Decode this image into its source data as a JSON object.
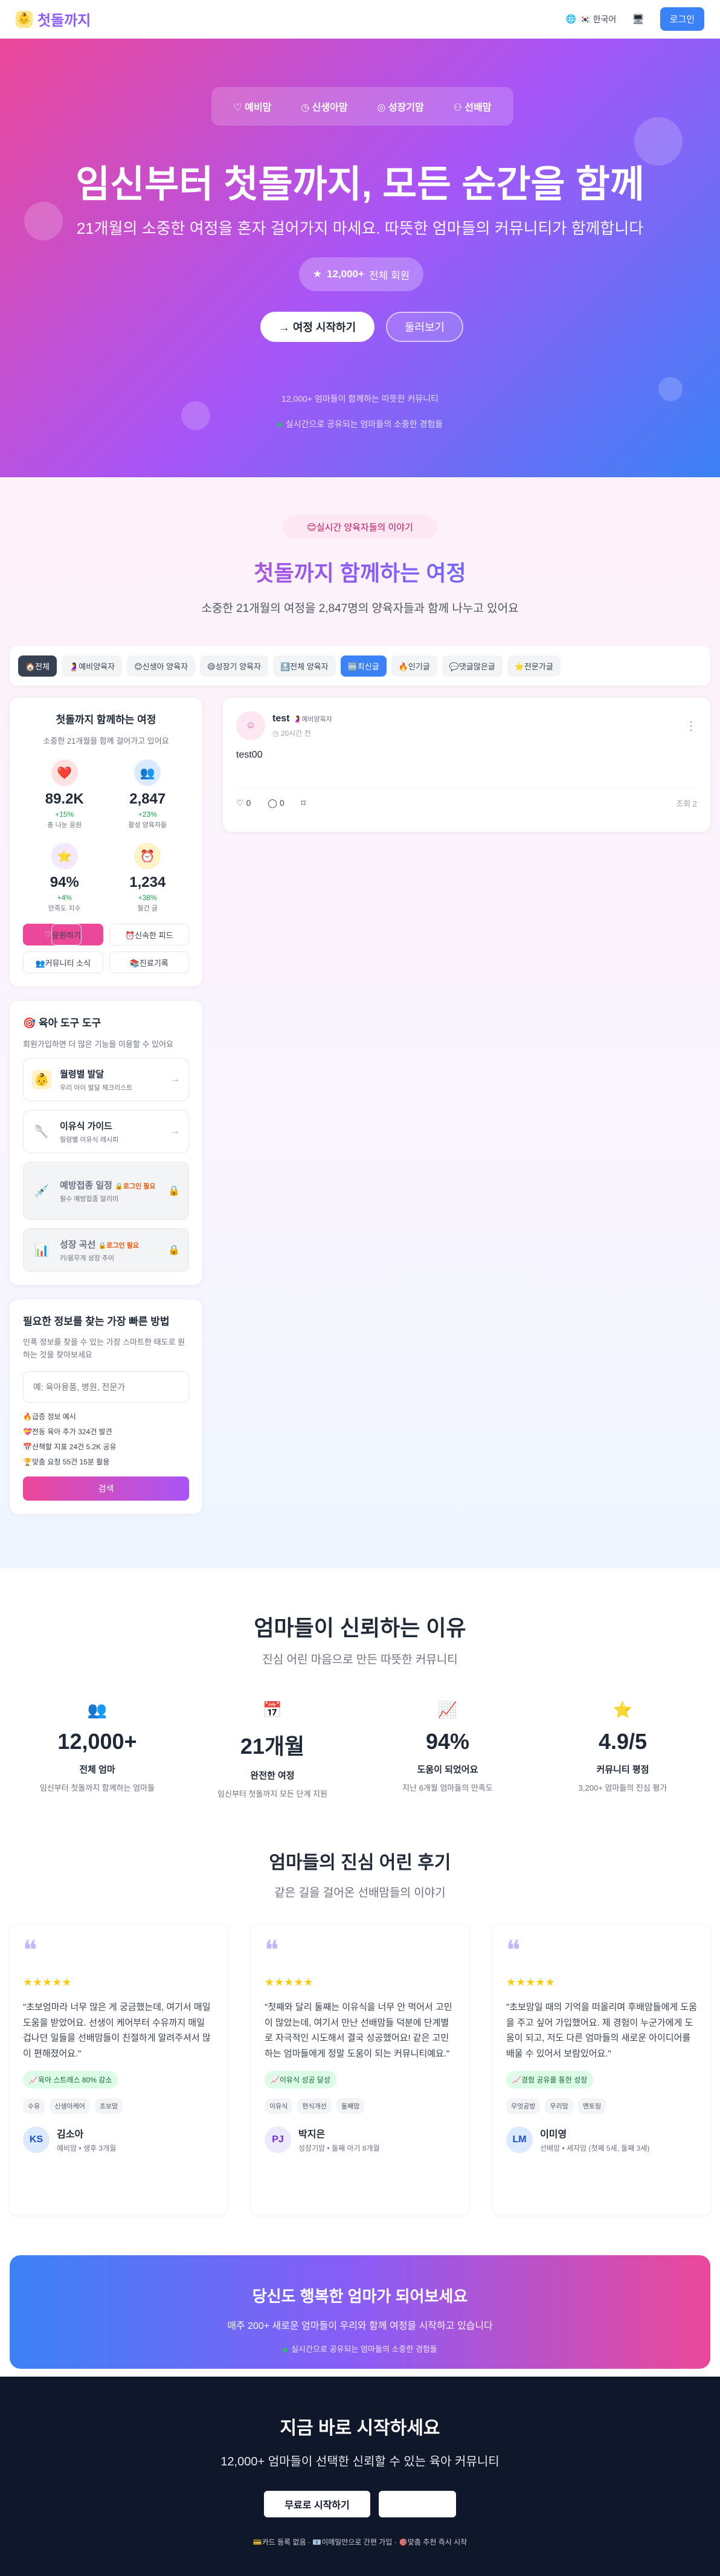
{
  "nav": {
    "logo": "첫돌까지",
    "lang": "🇰🇷 한국어",
    "login": "로그인"
  },
  "hero": {
    "tabs": [
      "예비맘",
      "신생아맘",
      "성장기맘",
      "선배맘"
    ],
    "title": "임신부터 첫돌까지, 모든 순간을 함께",
    "subtitle": "21개월의 소중한 여정을 혼자 걸어가지 마세요. 따뜻한 엄마들의 커뮤니티가 함께합니다",
    "members_count": "12,000+",
    "members_label": "전체 회원",
    "cta_primary": "여정 시작하기",
    "cta_secondary": "둘러보기",
    "note1": "12,000+ 엄마들이 함께하는 따뜻한 커뮤니티",
    "note2": "실시간으로 공유되는 엄마들의 소중한 경험들"
  },
  "journey": {
    "tag": "😊실시간 양육자들의 이야기",
    "title": "첫돌까지 함께하는 여정",
    "subtitle": "소중한 21개월의 여정을 2,847명의 양육자들과 함께 나누고 있어요",
    "filters": [
      "🏠전체",
      "🤰예비양육자",
      "😊신생아 양육자",
      "😄성장기 양육자",
      "🔝전체 양육자",
      "🆕최신글",
      "🔥인기글",
      "💬댓글많은글",
      "⭐전문가글"
    ]
  },
  "stats_card": {
    "title": "첫돌까지 함께하는 여정",
    "subtitle": "소중한 21개월을 함께 걸어가고 있어요",
    "items": [
      {
        "icon": "❤️",
        "value": "89.2K",
        "delta": "+15%",
        "label": "총 나눈 응원"
      },
      {
        "icon": "👥",
        "value": "2,847",
        "delta": "+23%",
        "label": "활성 양육자들"
      },
      {
        "icon": "⭐",
        "value": "94%",
        "delta": "+4%",
        "label": "만족도 지수"
      },
      {
        "icon": "⏰",
        "value": "1,234",
        "delta": "+38%",
        "label": "월간 글"
      }
    ],
    "buttons": [
      "응원하기",
      "⏰신속한 피드",
      "👥커뮤니티 소식",
      "📚진료기록"
    ]
  },
  "tools": {
    "title": "🎯 육아 도구 도구",
    "subtitle": "회원가입하면 더 많은 기능을 이용할 수 있어요",
    "items": [
      {
        "icon": "👶",
        "title": "월령별 발달",
        "desc": "우리 아이 발달 체크리스트",
        "lock": ""
      },
      {
        "icon": "🥄",
        "title": "이유식 가이드",
        "desc": "월령별 이유식 레시피",
        "lock": ""
      },
      {
        "icon": "💉",
        "title": "예방접종 일정",
        "desc": "필수 예방접종 알리미",
        "lock": "🔒로그인 필요"
      },
      {
        "icon": "📊",
        "title": "성장 곡선",
        "desc": "키/몸무게 성장 추이",
        "lock": "🔒로그인 필요"
      }
    ]
  },
  "search": {
    "title": "필요한 정보를 찾는 가장 빠른 방법",
    "desc": "인폭 정보를 찾을 수 있는 가장 스마트한 태도로 원하는 것을 찾아보세요",
    "placeholder": "예: 육아용품, 병원, 전문가",
    "trend_title": "🔥급증 정보 예시",
    "trends": [
      "💝전동 육아 추가 324건 발견",
      "📅산책할 지표 24건 5.2K 공유",
      "🏆맞춤 요청 55건 15분 활용"
    ],
    "button": "검색"
  },
  "post": {
    "avatar": "☺",
    "author": "test",
    "badge": "🤰예비양육자",
    "time": "20시간 전",
    "body": "test00",
    "likes": "0",
    "comments": "0",
    "views": "조회 2"
  },
  "trust": {
    "title": "엄마들이 신뢰하는 이유",
    "subtitle": "진심 어린 마음으로 만든 따뜻한 커뮤니티",
    "stats": [
      {
        "icon": "👥",
        "value": "12,000+",
        "title": "전체 엄마",
        "desc": "임신부터 첫돌까지 함께하는 엄마들"
      },
      {
        "icon": "📅",
        "value": "21개월",
        "title": "완전한 여정",
        "desc": "임신부터 첫돌까지 모든 단계 지원"
      },
      {
        "icon": "📈",
        "value": "94%",
        "title": "도움이 되었어요",
        "desc": "지난 6개월 엄마들의 만족도"
      },
      {
        "icon": "⭐",
        "value": "4.9/5",
        "title": "커뮤니티 평점",
        "desc": "3,200+ 엄마들의 진심 평가"
      }
    ]
  },
  "reviews": {
    "title": "엄마들의 진심 어린 후기",
    "subtitle": "같은 길을 걸어온 선배맘들의 이야기",
    "items": [
      {
        "text": "\"초보엄마라 너무 많은 게 궁금했는데, 여기서 매일 도움을 받았어요. 선생이 케어부터 수유까지 매일 겁나던 일들을 선배맘들이 친절하게 알려주셔서 많이 편해졌어요.\"",
        "result": "📈육아 스트레스 80% 감소",
        "tags": [
          "수유",
          "신생아케어",
          "초보맘"
        ],
        "initials": "KS",
        "name": "김소아",
        "meta": "예비맘 • 생후 3개월"
      },
      {
        "text": "\"첫째와 달리 둘째는 이유식을 너무 안 먹어서 고민이 많았는데, 여기서 만난 선배맘들 덕분에 단계별로 자극적인 시도해서 결국 성공했어요! 같은 고민하는 엄마들에게 정말 도움이 되는 커뮤니티예요.\"",
        "result": "📈이유식 성공 달성",
        "tags": [
          "이유식",
          "편식개선",
          "둘째맘"
        ],
        "initials": "PJ",
        "name": "박지은",
        "meta": "성장기맘 • 둘째 아기 8개월"
      },
      {
        "text": "\"초보맘일 때의 기억을 떠올리며 후배맘들에게 도움을 주고 싶어 가입했어요. 제 경험이 누군가에게 도움이 되고, 저도 다른 엄마들의 새로운 아이디어를 배울 수 있어서 보람있어요.\"",
        "result": "📈경험 공유를 통한 성장",
        "tags": [
          "무엇공방",
          "우리맘",
          "멘토링"
        ],
        "initials": "LM",
        "name": "이미영",
        "meta": "선배맘 • 세자맘 (첫째 5세, 둘째 3세)"
      }
    ]
  },
  "banner": {
    "title": "당신도 행복한 엄마가 되어보세요",
    "desc": "매주 200+ 새로운 엄마들이 우리와 함께 여정을 시작하고 있습니다",
    "note": "실시간으로 공유되는 엄마들의 소중한 경험들"
  },
  "footer": {
    "title": "지금 바로 시작하세요",
    "subtitle": "12,000+ 엄마들이 선택한 신뢰할 수 있는 육아 커뮤니티",
    "cta": "무료로 시작하기",
    "bullets": "💳카드 등록 없음 · 📧이메일만으로 간편 가입 · 🎯맞춤 추천 즉시 시작"
  }
}
